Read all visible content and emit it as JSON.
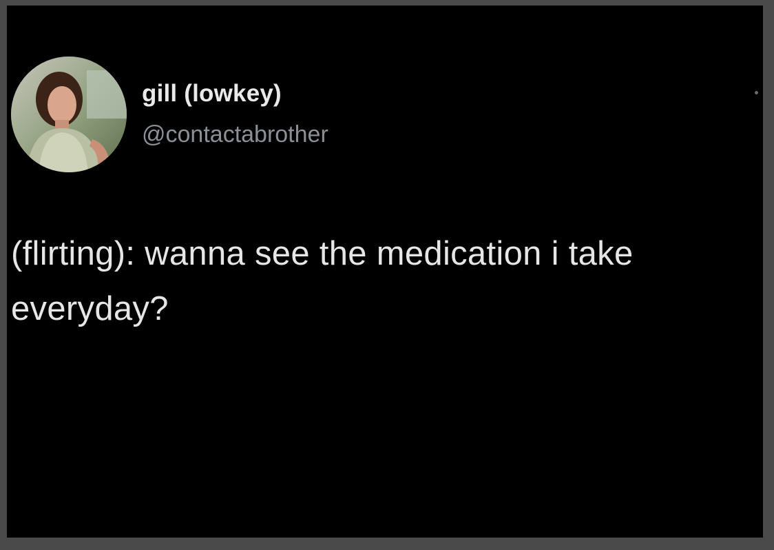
{
  "tweet": {
    "author": {
      "display_name": "gill (lowkey)",
      "handle": "@contactabrother",
      "avatar": "profile-photo"
    },
    "text": "(flirting): wanna see the medication i take everyday?",
    "more_icon": "more-dot-icon"
  },
  "colors": {
    "background": "#000000",
    "frame": "#4a4a4a",
    "name": "#e9e9e9",
    "handle": "#8b9097",
    "text": "#e6e6e6"
  }
}
